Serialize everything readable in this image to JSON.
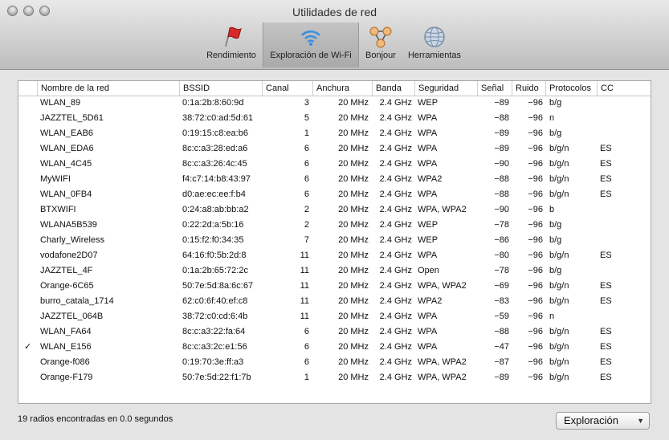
{
  "window": {
    "title": "Utilidades de red"
  },
  "toolbar": [
    {
      "label": "Rendimiento",
      "icon": "flag-icon"
    },
    {
      "label": "Exploración de Wi-Fi",
      "icon": "wifi-icon",
      "selected": true
    },
    {
      "label": "Bonjour",
      "icon": "bonjour-icon"
    },
    {
      "label": "Herramientas",
      "icon": "globe-icon"
    }
  ],
  "table": {
    "columns": [
      "Nombre de la red",
      "BSSID",
      "Canal",
      "Anchura",
      "Banda",
      "Seguridad",
      "Señal",
      "Ruido",
      "Protocolos",
      "CC"
    ],
    "rows": [
      {
        "checked": false,
        "name": "WLAN_89",
        "bssid": "0:1a:2b:8:60:9d",
        "channel": "3",
        "width": "20 MHz",
        "band": "2.4 GHz",
        "security": "WEP",
        "signal": "−89",
        "noise": "−96",
        "protocols": "b/g",
        "cc": ""
      },
      {
        "checked": false,
        "name": "JAZZTEL_5D61",
        "bssid": "38:72:c0:ad:5d:61",
        "channel": "5",
        "width": "20 MHz",
        "band": "2.4 GHz",
        "security": "WPA",
        "signal": "−88",
        "noise": "−96",
        "protocols": "n",
        "cc": ""
      },
      {
        "checked": false,
        "name": "WLAN_EAB6",
        "bssid": "0:19:15:c8:ea:b6",
        "channel": "1",
        "width": "20 MHz",
        "band": "2.4 GHz",
        "security": "WPA",
        "signal": "−89",
        "noise": "−96",
        "protocols": "b/g",
        "cc": ""
      },
      {
        "checked": false,
        "name": "WLAN_EDA6",
        "bssid": "8c:c:a3:28:ed:a6",
        "channel": "6",
        "width": "20 MHz",
        "band": "2.4 GHz",
        "security": "WPA",
        "signal": "−89",
        "noise": "−96",
        "protocols": "b/g/n",
        "cc": "ES"
      },
      {
        "checked": false,
        "name": "WLAN_4C45",
        "bssid": "8c:c:a3:26:4c:45",
        "channel": "6",
        "width": "20 MHz",
        "band": "2.4 GHz",
        "security": "WPA",
        "signal": "−90",
        "noise": "−96",
        "protocols": "b/g/n",
        "cc": "ES"
      },
      {
        "checked": false,
        "name": "MyWIFI",
        "bssid": "f4:c7:14:b8:43:97",
        "channel": "6",
        "width": "20 MHz",
        "band": "2.4 GHz",
        "security": "WPA2",
        "signal": "−88",
        "noise": "−96",
        "protocols": "b/g/n",
        "cc": "ES"
      },
      {
        "checked": false,
        "name": "WLAN_0FB4",
        "bssid": "d0:ae:ec:ee:f:b4",
        "channel": "6",
        "width": "20 MHz",
        "band": "2.4 GHz",
        "security": "WPA",
        "signal": "−88",
        "noise": "−96",
        "protocols": "b/g/n",
        "cc": "ES"
      },
      {
        "checked": false,
        "name": "BTXWIFI",
        "bssid": "0:24:a8:ab:bb:a2",
        "channel": "2",
        "width": "20 MHz",
        "band": "2.4 GHz",
        "security": "WPA, WPA2",
        "signal": "−90",
        "noise": "−96",
        "protocols": "b",
        "cc": ""
      },
      {
        "checked": false,
        "name": "WLANA5B539",
        "bssid": "0:22:2d:a:5b:16",
        "channel": "2",
        "width": "20 MHz",
        "band": "2.4 GHz",
        "security": "WEP",
        "signal": "−78",
        "noise": "−96",
        "protocols": "b/g",
        "cc": ""
      },
      {
        "checked": false,
        "name": "Charly_Wireless",
        "bssid": "0:15:f2:f0:34:35",
        "channel": "7",
        "width": "20 MHz",
        "band": "2.4 GHz",
        "security": "WEP",
        "signal": "−86",
        "noise": "−96",
        "protocols": "b/g",
        "cc": ""
      },
      {
        "checked": false,
        "name": "vodafone2D07",
        "bssid": "64:16:f0:5b:2d:8",
        "channel": "11",
        "width": "20 MHz",
        "band": "2.4 GHz",
        "security": "WPA",
        "signal": "−80",
        "noise": "−96",
        "protocols": "b/g/n",
        "cc": "ES"
      },
      {
        "checked": false,
        "name": "JAZZTEL_4F",
        "bssid": "0:1a:2b:65:72:2c",
        "channel": "11",
        "width": "20 MHz",
        "band": "2.4 GHz",
        "security": "Open",
        "signal": "−78",
        "noise": "−96",
        "protocols": "b/g",
        "cc": ""
      },
      {
        "checked": false,
        "name": "Orange-6C65",
        "bssid": "50:7e:5d:8a:6c:67",
        "channel": "11",
        "width": "20 MHz",
        "band": "2.4 GHz",
        "security": "WPA, WPA2",
        "signal": "−69",
        "noise": "−96",
        "protocols": "b/g/n",
        "cc": "ES"
      },
      {
        "checked": false,
        "name": "burro_catala_1714",
        "bssid": "62:c0:6f:40:ef:c8",
        "channel": "11",
        "width": "20 MHz",
        "band": "2.4 GHz",
        "security": "WPA2",
        "signal": "−83",
        "noise": "−96",
        "protocols": "b/g/n",
        "cc": "ES"
      },
      {
        "checked": false,
        "name": "JAZZTEL_064B",
        "bssid": "38:72:c0:cd:6:4b",
        "channel": "11",
        "width": "20 MHz",
        "band": "2.4 GHz",
        "security": "WPA",
        "signal": "−59",
        "noise": "−96",
        "protocols": "n",
        "cc": ""
      },
      {
        "checked": false,
        "name": "WLAN_FA64",
        "bssid": "8c:c:a3:22:fa:64",
        "channel": "6",
        "width": "20 MHz",
        "band": "2.4 GHz",
        "security": "WPA",
        "signal": "−88",
        "noise": "−96",
        "protocols": "b/g/n",
        "cc": "ES"
      },
      {
        "checked": true,
        "name": "WLAN_E156",
        "bssid": "8c:c:a3:2c:e1:56",
        "channel": "6",
        "width": "20 MHz",
        "band": "2.4 GHz",
        "security": "WPA",
        "signal": "−47",
        "noise": "−96",
        "protocols": "b/g/n",
        "cc": "ES"
      },
      {
        "checked": false,
        "name": "Orange-f086",
        "bssid": "0:19:70:3e:ff:a3",
        "channel": "6",
        "width": "20 MHz",
        "band": "2.4 GHz",
        "security": "WPA, WPA2",
        "signal": "−87",
        "noise": "−96",
        "protocols": "b/g/n",
        "cc": "ES"
      },
      {
        "checked": false,
        "name": "Orange-F179",
        "bssid": "50:7e:5d:22:f1:7b",
        "channel": "1",
        "width": "20 MHz",
        "band": "2.4 GHz",
        "security": "WPA, WPA2",
        "signal": "−89",
        "noise": "−96",
        "protocols": "b/g/n",
        "cc": "ES"
      }
    ]
  },
  "status": {
    "text": "19 radios encontradas en 0.0 segundos"
  },
  "popup": {
    "selected": "Exploración"
  },
  "icons": {
    "check": "✓",
    "popup_arrow": "▼"
  }
}
